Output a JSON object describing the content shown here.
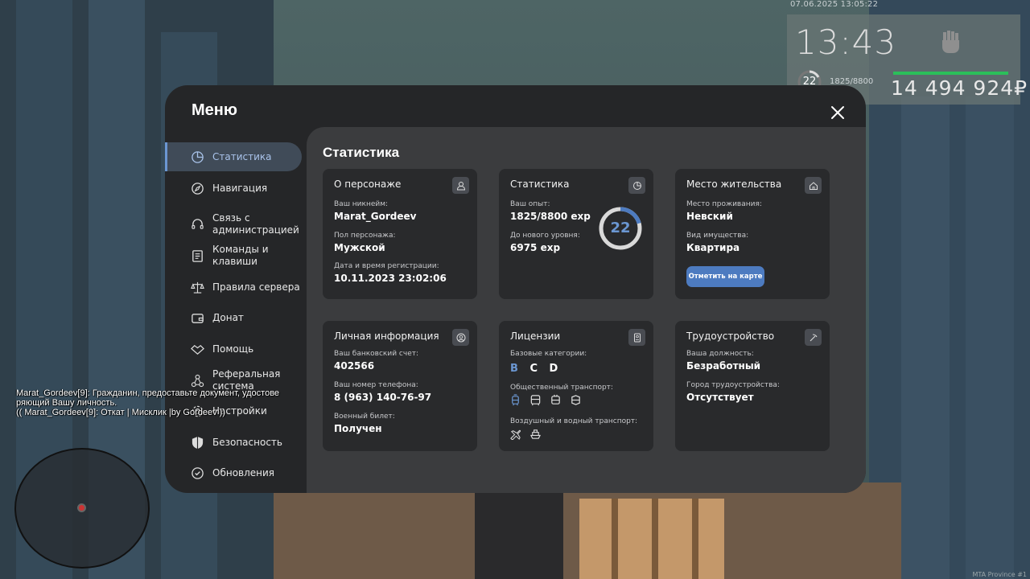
{
  "hud": {
    "timestamp": "07.06.2025 13:05:22",
    "clock": "13:43",
    "level": "22",
    "exp": "1825/8800",
    "money": "14 494 924₽",
    "watermark": "MTA Province #1"
  },
  "menu": {
    "title": "Меню",
    "close_icon": "close-icon"
  },
  "sidebar": {
    "items": [
      {
        "label": "Статистика",
        "icon": "stats-icon",
        "active": true
      },
      {
        "label": "Навигация",
        "icon": "compass-icon"
      },
      {
        "label": "Связь с администрацией",
        "icon": "headset-icon"
      },
      {
        "label": "Команды и клавиши",
        "icon": "document-icon"
      },
      {
        "label": "Правила сервера",
        "icon": "scales-icon"
      },
      {
        "label": "Донат",
        "icon": "wallet-icon"
      },
      {
        "label": "Помощь",
        "icon": "handshake-icon"
      },
      {
        "label": "Реферальная система",
        "icon": "network-icon"
      },
      {
        "label": "Настройки",
        "icon": "gear-icon"
      },
      {
        "label": "Безопасность",
        "icon": "shield-icon"
      },
      {
        "label": "Обновления",
        "icon": "refresh-icon"
      }
    ]
  },
  "content": {
    "title": "Статистика",
    "character": {
      "title": "О персонаже",
      "nickname_label": "Ваш никнейм:",
      "nickname": "Marat_Gordeev",
      "gender_label": "Пол персонажа:",
      "gender": "Мужской",
      "reg_label": "Дата и время регистрации:",
      "reg": "10.11.2023 23:02:06"
    },
    "stats": {
      "title": "Статистика",
      "exp_label": "Ваш опыт:",
      "exp": "1825/8800 exp",
      "next_label": "До нового уровня:",
      "next": "6975 exp",
      "level": "22",
      "progress": 0.207
    },
    "residence": {
      "title": "Место жительства",
      "place_label": "Место проживания:",
      "place": "Невский",
      "type_label": "Вид имущества:",
      "type": "Квартира",
      "button": "Отметить на карте"
    },
    "personal": {
      "title": "Личная информация",
      "bank_label": "Ваш банковский счет:",
      "bank": "402566",
      "phone_label": "Ваш номер телефона:",
      "phone": "8 (963) 140-76-97",
      "military_label": "Военный билет:",
      "military": "Получен"
    },
    "licenses": {
      "title": "Лицензии",
      "base_label": "Базовые категории:",
      "cat_b": "B",
      "cat_cd": "C D",
      "public_label": "Общественный транспорт:",
      "air_label": "Воздушный и водный транспорт:"
    },
    "job": {
      "title": "Трудоустройство",
      "position_label": "Ваша должность:",
      "position": "Безработный",
      "city_label": "Город трудоустройства:",
      "city": "Отсутствует"
    }
  },
  "chat": {
    "lines": [
      "Marat_Gordeev[9]: Гражданин, предоставьте документ, удостове",
      "ряющий Вашу личность.",
      "(( Marat_Gordeev[9]: Откат | Мисклик |by Gordeev ))"
    ]
  }
}
